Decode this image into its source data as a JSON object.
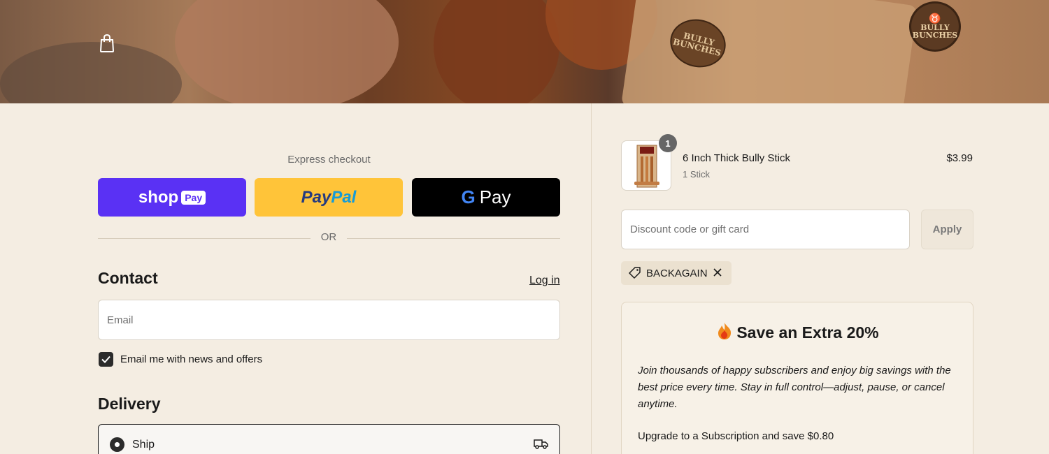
{
  "banner": {
    "brand_seal": "BULLY BUNCHES",
    "bag_logo": "BULLY BUNCHES"
  },
  "express": {
    "label": "Express checkout",
    "shop_pay": {
      "shop": "shop",
      "pay": "Pay"
    },
    "paypal": {
      "part1": "Pay",
      "part2": "Pal"
    },
    "gpay": {
      "g": "G",
      "pay": "Pay"
    },
    "or": "OR"
  },
  "contact": {
    "title": "Contact",
    "login": "Log in",
    "email_placeholder": "Email",
    "newsletter_label": "Email me with news and offers",
    "newsletter_checked": true
  },
  "delivery": {
    "title": "Delivery",
    "option_label": "Ship",
    "selected": true
  },
  "order": {
    "item": {
      "name": "6 Inch Thick Bully Stick",
      "variant": "1 Stick",
      "price": "$3.99",
      "quantity": "1"
    },
    "discount_placeholder": "Discount code or gift card",
    "apply_label": "Apply",
    "applied_code": "BACKAGAIN"
  },
  "promo": {
    "icon": "fire",
    "title": "Save an Extra 20%",
    "body": "Join thousands of happy subscribers and enjoy big savings with the best price every time. Stay in full control—adjust, pause, or cancel anytime.",
    "cta": "Upgrade to a Subscription and save $0.80"
  },
  "colors": {
    "background": "#f4ede2",
    "shop_pay": "#5a31f4",
    "paypal": "#ffc439",
    "gpay": "#000000"
  }
}
